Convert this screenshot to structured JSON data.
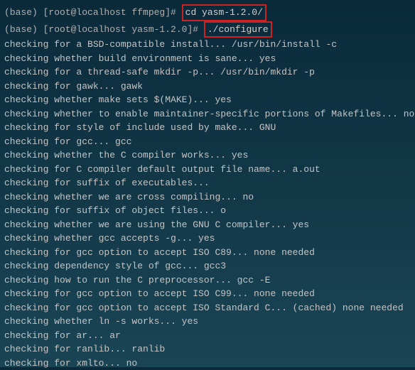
{
  "prompt1": {
    "env": "(base) ",
    "user": "[root@localhost ffmpeg]# ",
    "command": "cd yasm-1.2.0/"
  },
  "prompt2": {
    "env": "(base) ",
    "user": "[root@localhost yasm-1.2.0]# ",
    "command": "./configure"
  },
  "output": [
    "checking for a BSD-compatible install... /usr/bin/install -c",
    "checking whether build environment is sane... yes",
    "checking for a thread-safe mkdir -p... /usr/bin/mkdir -p",
    "checking for gawk... gawk",
    "checking whether make sets $(MAKE)... yes",
    "checking whether to enable maintainer-specific portions of Makefiles... no",
    "checking for style of include used by make... GNU",
    "checking for gcc... gcc",
    "checking whether the C compiler works... yes",
    "checking for C compiler default output file name... a.out",
    "checking for suffix of executables... ",
    "checking whether we are cross compiling... no",
    "checking for suffix of object files... o",
    "checking whether we are using the GNU C compiler... yes",
    "checking whether gcc accepts -g... yes",
    "checking for gcc option to accept ISO C89... none needed",
    "checking dependency style of gcc... gcc3",
    "checking how to run the C preprocessor... gcc -E",
    "checking for gcc option to accept ISO C99... none needed",
    "checking for gcc option to accept ISO Standard C... (cached) none needed",
    "checking whether ln -s works... yes",
    "checking for ar... ar",
    "checking for ranlib... ranlib",
    "checking for xmlto... no"
  ]
}
